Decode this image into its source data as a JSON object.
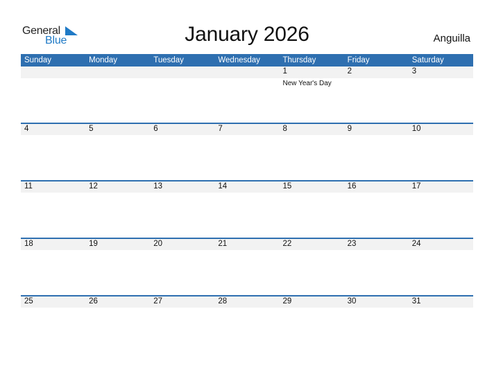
{
  "brand": {
    "general": "General",
    "blue": "Blue",
    "accent_color": "#1f7ac6"
  },
  "title": "January 2026",
  "country": "Anguilla",
  "colors": {
    "header_bg": "#2e6fb0",
    "date_row_bg": "#f2f2f2"
  },
  "weekdays": [
    "Sunday",
    "Monday",
    "Tuesday",
    "Wednesday",
    "Thursday",
    "Friday",
    "Saturday"
  ],
  "weeks": [
    {
      "days": [
        "",
        "",
        "",
        "",
        "1",
        "2",
        "3"
      ],
      "events": [
        "",
        "",
        "",
        "",
        "New Year's Day",
        "",
        ""
      ]
    },
    {
      "days": [
        "4",
        "5",
        "6",
        "7",
        "8",
        "9",
        "10"
      ],
      "events": [
        "",
        "",
        "",
        "",
        "",
        "",
        ""
      ]
    },
    {
      "days": [
        "11",
        "12",
        "13",
        "14",
        "15",
        "16",
        "17"
      ],
      "events": [
        "",
        "",
        "",
        "",
        "",
        "",
        ""
      ]
    },
    {
      "days": [
        "18",
        "19",
        "20",
        "21",
        "22",
        "23",
        "24"
      ],
      "events": [
        "",
        "",
        "",
        "",
        "",
        "",
        ""
      ]
    },
    {
      "days": [
        "25",
        "26",
        "27",
        "28",
        "29",
        "30",
        "31"
      ],
      "events": [
        "",
        "",
        "",
        "",
        "",
        "",
        ""
      ]
    }
  ]
}
